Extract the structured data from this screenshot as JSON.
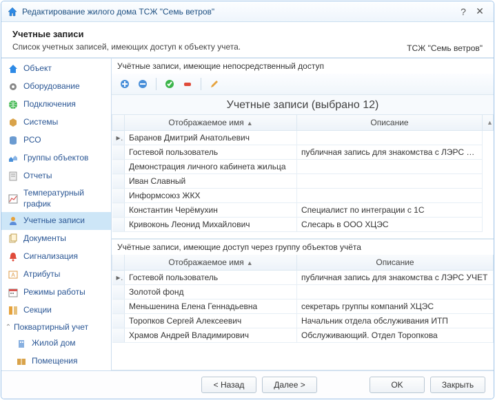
{
  "title": "Редактирование жилого дома ТСЖ \"Семь ветров\"",
  "header": {
    "title": "Учетные записи",
    "subtitle": "Список учетных записей, имеющих доступ к объекту учета.",
    "org": "ТСЖ \"Семь ветров\""
  },
  "sidebar": {
    "items": [
      {
        "id": "object",
        "label": "Объект"
      },
      {
        "id": "equipment",
        "label": "Оборудование"
      },
      {
        "id": "connections",
        "label": "Подключения"
      },
      {
        "id": "systems",
        "label": "Системы"
      },
      {
        "id": "rso",
        "label": "РСО"
      },
      {
        "id": "groups",
        "label": "Группы объектов"
      },
      {
        "id": "reports",
        "label": "Отчеты"
      },
      {
        "id": "tempgraph",
        "label": "Температурный график"
      },
      {
        "id": "accounts",
        "label": "Учетные записи",
        "selected": true
      },
      {
        "id": "documents",
        "label": "Документы"
      },
      {
        "id": "alarms",
        "label": "Сигнализация"
      },
      {
        "id": "attributes",
        "label": "Атрибуты"
      },
      {
        "id": "modes",
        "label": "Режимы работы"
      },
      {
        "id": "sections",
        "label": "Секции"
      }
    ],
    "group": {
      "label": "Поквартирный учет",
      "children": [
        {
          "id": "house",
          "label": "Жилой дом"
        },
        {
          "id": "rooms",
          "label": "Помещения"
        }
      ]
    }
  },
  "main": {
    "direct_label": "Учётные записи, имеющие непосредственный доступ",
    "grid_title": "Учетные записи (выбрано 12)",
    "col_name": "Отображаемое имя",
    "col_desc": "Описание",
    "rows": [
      {
        "name": "Баранов Дмитрий Анатольевич",
        "desc": ""
      },
      {
        "name": "Гостевой пользователь",
        "desc": "публичная запись для знакомства с ЛЭРС УЧЕТ"
      },
      {
        "name": "Демонстрация личного кабинета жильца",
        "desc": ""
      },
      {
        "name": "Иван Славный",
        "desc": ""
      },
      {
        "name": "Информсоюз ЖКХ",
        "desc": ""
      },
      {
        "name": "Константин Черёмухин",
        "desc": "Специалист по интеграции с 1С"
      },
      {
        "name": "Кривоконь Леонид Михайлович",
        "desc": "Слесарь в ООО ХЦЭС"
      }
    ],
    "group_label": "Учётные записи, имеющие доступ через группу объектов учёта",
    "group_rows": [
      {
        "name": "Гостевой пользователь",
        "desc": "публичная запись для знакомства с ЛЭРС УЧЕТ"
      },
      {
        "name": "Золотой фонд",
        "desc": ""
      },
      {
        "name": "Меньшенина Елена Геннадьевна",
        "desc": "секретарь группы компаний ХЦЭС"
      },
      {
        "name": "Торопков Сергей Алексеевич",
        "desc": "Начальник отдела обслуживания ИТП"
      },
      {
        "name": "Храмов Андрей Владимирович",
        "desc": "Обслуживающий. Отдел Торопкова"
      }
    ]
  },
  "footer": {
    "back": "< Назад",
    "next": "Далее >",
    "ok": "OK",
    "close": "Закрыть"
  }
}
